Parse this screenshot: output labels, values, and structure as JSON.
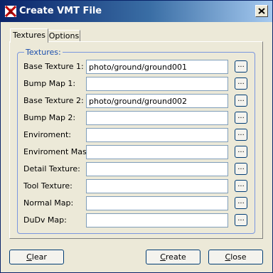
{
  "window": {
    "title": "Create VMT File",
    "icon": "app-logo-icon"
  },
  "tabs": [
    {
      "label": "Textures",
      "active": true
    },
    {
      "label": "Options",
      "active": false
    }
  ],
  "group": {
    "legend": "Textures:"
  },
  "fields": [
    {
      "label": "Base Texture 1:",
      "value": "photo/ground/ground001",
      "button": "..."
    },
    {
      "label": "Bump Map 1:",
      "value": "",
      "button": "..."
    },
    {
      "label": "Base Texture 2:",
      "value": "photo/ground/ground002",
      "button": "..."
    },
    {
      "label": "Bump Map 2:",
      "value": "",
      "button": "..."
    },
    {
      "label": "Enviroment:",
      "value": "",
      "button": "..."
    },
    {
      "label": "Enviroment Mask:",
      "value": "",
      "button": "..."
    },
    {
      "label": "Detail Texture:",
      "value": "",
      "button": "..."
    },
    {
      "label": "Tool Texture:",
      "value": "",
      "button": "..."
    },
    {
      "label": "Normal Map:",
      "value": "",
      "button": "..."
    },
    {
      "label": "DuDv Map:",
      "value": "",
      "button": "..."
    }
  ],
  "buttons": {
    "clear": {
      "mnemonic": "C",
      "rest": "lear"
    },
    "create": {
      "mnemonic": "C",
      "rest": "reate"
    },
    "close": {
      "mnemonic": "C",
      "rest": "lose"
    }
  },
  "colors": {
    "titlebar_start": "#0a246a",
    "titlebar_end": "#a6caf0",
    "window_bg": "#ece9d8",
    "group_legend": "#1c4fad"
  }
}
